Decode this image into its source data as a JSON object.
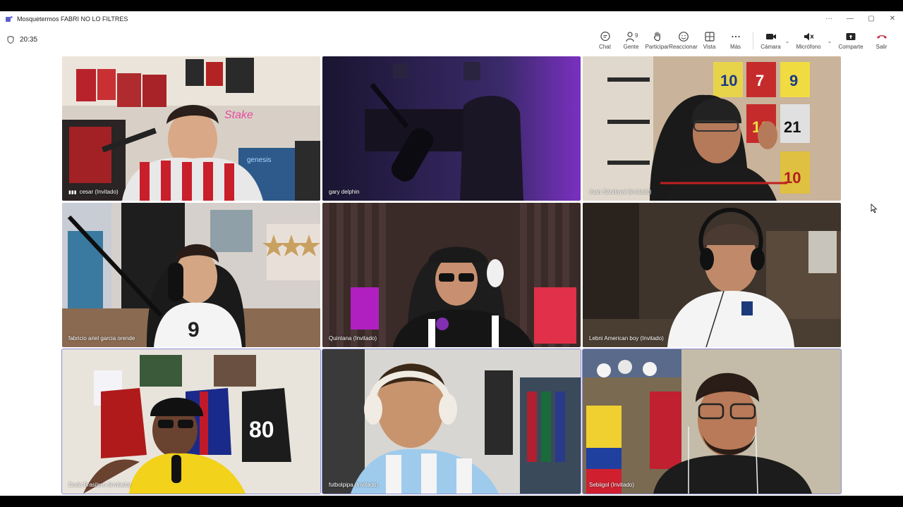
{
  "window": {
    "title": "Mosquetermos FABRI NO LO FILTRES"
  },
  "timer": {
    "value": "20:35",
    "icon": "shield-icon"
  },
  "toolbar": {
    "chat": "Chat",
    "people": "Gente",
    "people_count": "9",
    "raise": "Participar",
    "react": "Reaccionar",
    "view": "Vista",
    "more": "Más",
    "camera": "Cámara",
    "mic": "Micrófono",
    "share": "Comparte",
    "leave": "Salir"
  },
  "colors": {
    "accent": "#8a8cd4",
    "leave": "#c4314b",
    "toolbar_bg": "#ffffff"
  },
  "participants": [
    {
      "name": "cesar (Invitado)"
    },
    {
      "name": "gary delphin"
    },
    {
      "name": "Juan Sandoval (Invitado)"
    },
    {
      "name": "fabricio ariel garcia orende"
    },
    {
      "name": "Quintana (Invitado)"
    },
    {
      "name": "Lebni American boy (Invitado)"
    },
    {
      "name": "Duda Brasilero (Invitado)"
    },
    {
      "name": "futbolpipa (Invitado)"
    },
    {
      "name": "Sebiigol (Invitado)"
    }
  ]
}
